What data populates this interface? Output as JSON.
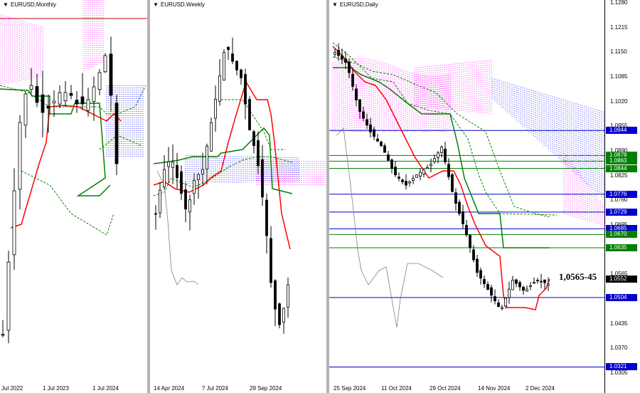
{
  "panels": [
    {
      "title": "EURUSD,Monthly",
      "x_labels": [
        "Jul 2022",
        "1 Jul 2023",
        "1 Jul 2024"
      ]
    },
    {
      "title": "EURUSD,Weekly",
      "x_labels": [
        "14 Apr 2024",
        "7 Jul 2024",
        "29 Sep 2024"
      ]
    },
    {
      "title": "EURUSD,Daily",
      "x_labels": [
        "25 Sep 2024",
        "11 Oct 2024",
        "29 Oct 2024",
        "14 Nov 2024",
        "2 Dec 2024"
      ]
    }
  ],
  "annotation": "1,0565-45",
  "colors": {
    "tenkan": "#ff0000",
    "kijun": "#008000",
    "cloud_bear": "#ff00ff",
    "cloud_bull": "#0000ff",
    "chikou": "#808080",
    "level_blue": "#0000cc",
    "level_green": "#008000"
  },
  "chart_data": [
    {
      "type": "candlestick",
      "timeframe": "Monthly",
      "indicators": [
        "Ichimoku tenkan (red)",
        "Ichimoku kijun (green)",
        "Ichimoku cloud (magenta / blue dotted)",
        "dashed green levels"
      ]
    },
    {
      "type": "candlestick",
      "timeframe": "Weekly",
      "indicators": [
        "Ichimoku tenkan (red)",
        "Ichimoku kijun (green)",
        "Ichimoku cloud (blue / magenta dotted)",
        "chikou (grey)"
      ]
    },
    {
      "type": "candlestick",
      "timeframe": "Daily",
      "ylim": [
        1.0305,
        1.128
      ],
      "y_ticks": [
        "1.1280",
        "1.1215",
        "1.1150",
        "1.1085",
        "1.1020",
        "1.0955",
        "1.0890",
        "1.0825",
        "1.0760",
        "1.0695",
        "1.0630",
        "1.0565",
        "1.0500",
        "1.0435",
        "1.0370",
        "1.0305"
      ],
      "levels": [
        {
          "label": "1.0944",
          "value": 1.0944,
          "color": "blue"
        },
        {
          "label": "1.0878",
          "value": 1.0878,
          "color": "green"
        },
        {
          "label": "1.0863",
          "value": 1.0863,
          "color": "green"
        },
        {
          "label": "1.0844",
          "value": 1.0844,
          "color": "green"
        },
        {
          "label": "1.0776",
          "value": 1.0776,
          "color": "blue"
        },
        {
          "label": "1.0729",
          "value": 1.0729,
          "color": "blue"
        },
        {
          "label": "1.0685",
          "value": 1.0685,
          "color": "blue"
        },
        {
          "label": "1.0670",
          "value": 1.067,
          "color": "green"
        },
        {
          "label": "1.0635",
          "value": 1.0635,
          "color": "green"
        },
        {
          "label": "1.0504",
          "value": 1.0504,
          "color": "blue"
        },
        {
          "label": "1.0321",
          "value": 1.0321,
          "color": "blue"
        }
      ],
      "current_price": {
        "label": "1.0552",
        "value": 1.0552
      }
    }
  ]
}
